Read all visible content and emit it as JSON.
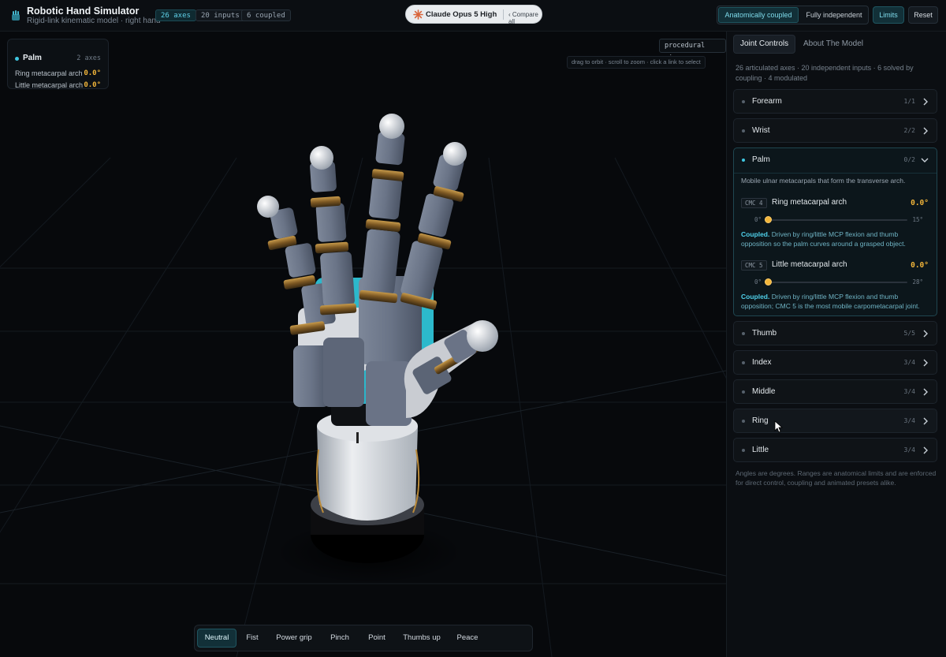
{
  "header": {
    "title": "Robotic Hand Simulator",
    "subtitle": "Rigid-link kinematic model · right hand",
    "badges": {
      "axes": "26 axes",
      "inputs": "20 inputs",
      "coupled": "6 coupled"
    },
    "model": {
      "name": "Claude Opus 5 High",
      "compare": "‹ Compare all"
    },
    "modes": {
      "coupled": "Anatomically coupled",
      "independent": "Fully independent",
      "active": "coupled"
    },
    "limits": "Limits",
    "reset": "Reset"
  },
  "viewport": {
    "selection": {
      "title": "Palm",
      "axes": "2 axes",
      "rows": [
        {
          "label": "Ring metacarpal arch",
          "value": "0.0°"
        },
        {
          "label": "Little metacarpal arch",
          "value": "0.0°"
        }
      ]
    },
    "rig_label": "procedural rig",
    "hint": "drag to orbit · scroll to zoom · click a link to select",
    "presets": [
      "Neutral",
      "Fist",
      "Power grip",
      "Pinch",
      "Point",
      "Thumbs up",
      "Peace"
    ],
    "active_preset": "Neutral"
  },
  "panel": {
    "tabs": [
      "Joint Controls",
      "About The Model"
    ],
    "active_tab": "Joint Controls",
    "summary": "26 articulated axes · 20 independent inputs · 6 solved by coupling · 4 modulated",
    "groups": [
      {
        "name": "Forearm",
        "count": "1/1",
        "expanded": false
      },
      {
        "name": "Wrist",
        "count": "2/2",
        "expanded": false
      },
      {
        "name": "Palm",
        "count": "0/2",
        "expanded": true
      },
      {
        "name": "Thumb",
        "count": "5/5",
        "expanded": false
      },
      {
        "name": "Index",
        "count": "3/4",
        "expanded": false
      },
      {
        "name": "Middle",
        "count": "3/4",
        "expanded": false
      },
      {
        "name": "Ring",
        "count": "3/4",
        "expanded": false
      },
      {
        "name": "Little",
        "count": "3/4",
        "expanded": false
      }
    ],
    "palm": {
      "description": "Mobile ulnar metacarpals that form the transverse arch.",
      "joints": [
        {
          "tag": "CMC 4",
          "name": "Ring metacarpal arch",
          "value": "0.0°",
          "min": "0°",
          "max": "15°",
          "level": 0,
          "note_strong": "Coupled.",
          "note": "Driven by ring/little MCP flexion and thumb opposition so the palm curves around a grasped object."
        },
        {
          "tag": "CMC 5",
          "name": "Little metacarpal arch",
          "value": "0.0°",
          "min": "0°",
          "max": "28°",
          "level": 0,
          "note_strong": "Coupled.",
          "note": "Driven by ring/little MCP flexion and thumb opposition; CMC 5 is the most mobile carpometacarpal joint."
        }
      ]
    },
    "footnote": "Angles are degrees. Ranges are anatomical limits and are enforced for direct control, coupling and animated presets alike."
  },
  "colors": {
    "accent": "#3fc6e0",
    "value": "#f2b53a",
    "background": "#07090c"
  }
}
